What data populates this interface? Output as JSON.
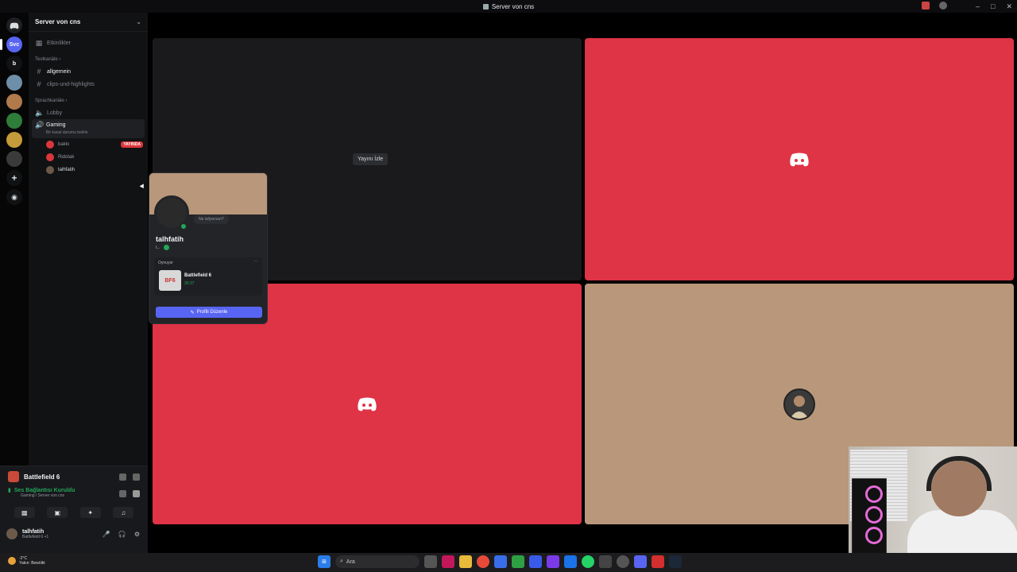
{
  "window": {
    "title": "Server von cns"
  },
  "rail": {
    "servers": [
      {
        "label": "Svc",
        "color": "#5865f2"
      },
      {
        "label": "b",
        "color": "#111214"
      },
      {
        "label": "",
        "color": "#6f8fa8"
      },
      {
        "label": "",
        "color": "#b07a4a"
      },
      {
        "label": "",
        "color": "#2f7d3a"
      },
      {
        "label": "",
        "color": "#c59a3a"
      },
      {
        "label": "",
        "color": "#3a3a3a"
      }
    ]
  },
  "sidebar": {
    "server_name": "Server von cns",
    "events": "Etkinlikler",
    "text_category": "Textkanäle",
    "text_channels": [
      "allgemein",
      "clips-und-highlights"
    ],
    "voice_category": "Sprachkanäle",
    "voice_channels": [
      "Lobby",
      "Gaming"
    ],
    "gaming_sub": "Bir kanal durumu belirle",
    "voice_users": [
      {
        "name": "bakkı",
        "live": "YAYINDA",
        "color": "#da373c"
      },
      {
        "name": "Ridotak",
        "color": "#da373c"
      },
      {
        "name": "talhfatih",
        "color": "#6b5a4a"
      }
    ]
  },
  "bottom": {
    "game": "Battlefield 6",
    "connection": "Ses Bağlantısı Kuruldu",
    "connection_sub": "Gaming / Server von cns",
    "user_name": "talhfatih",
    "user_status": "Battlefield 6 +1"
  },
  "stage": {
    "watch_stream": "Yayını İzle"
  },
  "popup": {
    "bubble": "Ne istiyorsun?",
    "name": "talhfatih",
    "tag": "t...",
    "activity_label": "Oynuyor",
    "game_icon_text": "BF6",
    "game_name": "Battlefield 6",
    "game_time": "35:37",
    "edit_button": "Profili Düzenle"
  },
  "taskbar": {
    "search_label": "Ara",
    "weather": "-2°C",
    "weather_sub": "Yakın: Bewölkt"
  }
}
